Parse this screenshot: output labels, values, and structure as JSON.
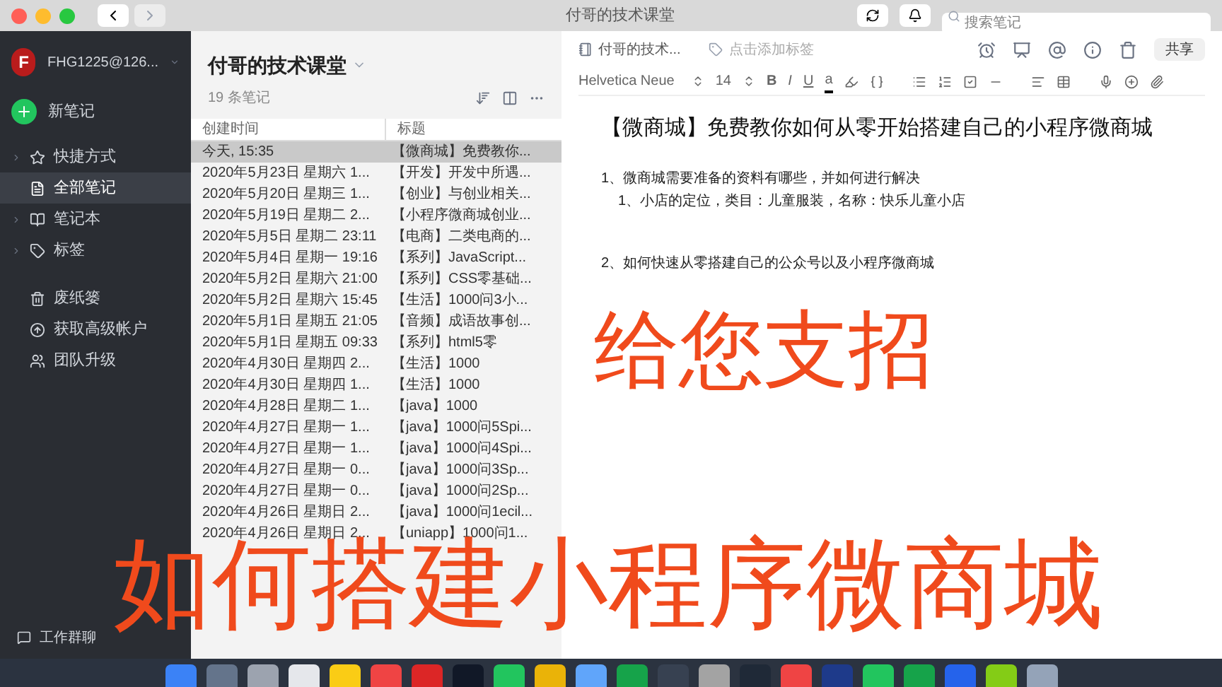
{
  "window": {
    "title": "付哥的技术课堂",
    "search": {
      "placeholder": "搜索笔记"
    }
  },
  "sidebar": {
    "account": "FHG1225@126...",
    "avatar_letter": "F",
    "new_note": "新笔记",
    "items": [
      {
        "label": "快捷方式",
        "expandable": true,
        "selected": false
      },
      {
        "label": "全部笔记",
        "expandable": false,
        "selected": true
      },
      {
        "label": "笔记本",
        "expandable": true,
        "selected": false
      },
      {
        "label": "标签",
        "expandable": true,
        "selected": false
      }
    ],
    "items2": [
      {
        "label": "废纸篓",
        "selected": false
      },
      {
        "label": "获取高级帐户",
        "selected": false
      },
      {
        "label": "团队升级",
        "selected": false
      }
    ],
    "footer": "工作群聊"
  },
  "list": {
    "title": "付哥的技术课堂",
    "count": "19 条笔记",
    "columns": [
      "创建时间",
      "标题"
    ],
    "rows": [
      {
        "date": "今天, 15:35",
        "title": "【微商城】免费教你...",
        "selected": true
      },
      {
        "date": "2020年5月23日 星期六 1...",
        "title": "【开发】开发中所遇...",
        "selected": false
      },
      {
        "date": "2020年5月20日 星期三 1...",
        "title": "【创业】与创业相关...",
        "selected": false
      },
      {
        "date": "2020年5月19日 星期二 2...",
        "title": "【小程序微商城创业...",
        "selected": false
      },
      {
        "date": "2020年5月5日 星期二 23:11",
        "title": "【电商】二类电商的...",
        "selected": false
      },
      {
        "date": "2020年5月4日 星期一 19:16",
        "title": "【系列】JavaScript...",
        "selected": false
      },
      {
        "date": "2020年5月2日 星期六 21:00",
        "title": "【系列】CSS零基础...",
        "selected": false
      },
      {
        "date": "2020年5月2日 星期六 15:45",
        "title": "【生活】1000问3小...",
        "selected": false
      },
      {
        "date": "2020年5月1日 星期五 21:05",
        "title": "【音频】成语故事创...",
        "selected": false
      },
      {
        "date": "2020年5月1日 星期五 09:33",
        "title": "【系列】html5零",
        "selected": false
      },
      {
        "date": "2020年4月30日 星期四 2...",
        "title": "【生活】1000",
        "selected": false
      },
      {
        "date": "2020年4月30日 星期四 1...",
        "title": "【生活】1000",
        "selected": false
      },
      {
        "date": "2020年4月28日 星期二 1...",
        "title": "【java】1000",
        "selected": false
      },
      {
        "date": "2020年4月27日 星期一 1...",
        "title": "【java】1000问5Spi...",
        "selected": false
      },
      {
        "date": "2020年4月27日 星期一 1...",
        "title": "【java】1000问4Spi...",
        "selected": false
      },
      {
        "date": "2020年4月27日 星期一 0...",
        "title": "【java】1000问3Sp...",
        "selected": false
      },
      {
        "date": "2020年4月27日 星期一 0...",
        "title": "【java】1000问2Sp...",
        "selected": false
      },
      {
        "date": "2020年4月26日 星期日 2...",
        "title": "【java】1000问1ecil...",
        "selected": false
      },
      {
        "date": "2020年4月26日 星期日 2...",
        "title": "【uniapp】1000问1...",
        "selected": false
      }
    ]
  },
  "editor": {
    "notebook": "付哥的技术...",
    "tag_placeholder": "点击添加标签",
    "share": "共享",
    "font": "Helvetica Neue",
    "size": "14",
    "format_letters": [
      "B",
      "I",
      "U",
      "a"
    ],
    "title": "【微商城】免费教你如何从零开始搭建自己的小程序微商城",
    "lines": [
      {
        "kind": "item",
        "text": "1、微商城需要准备的资料有哪些，并如何进行解决"
      },
      {
        "kind": "subitem",
        "text": "1、小店的定位，类目：儿童服装，名称：快乐儿童小店"
      },
      {
        "kind": "spaced_item",
        "text": "2、如何快速从零搭建自己的公众号以及小程序微商城"
      }
    ]
  },
  "captions": [
    {
      "text": "给您支招"
    },
    {
      "text": "如何搭建小程序微商城"
    }
  ]
}
